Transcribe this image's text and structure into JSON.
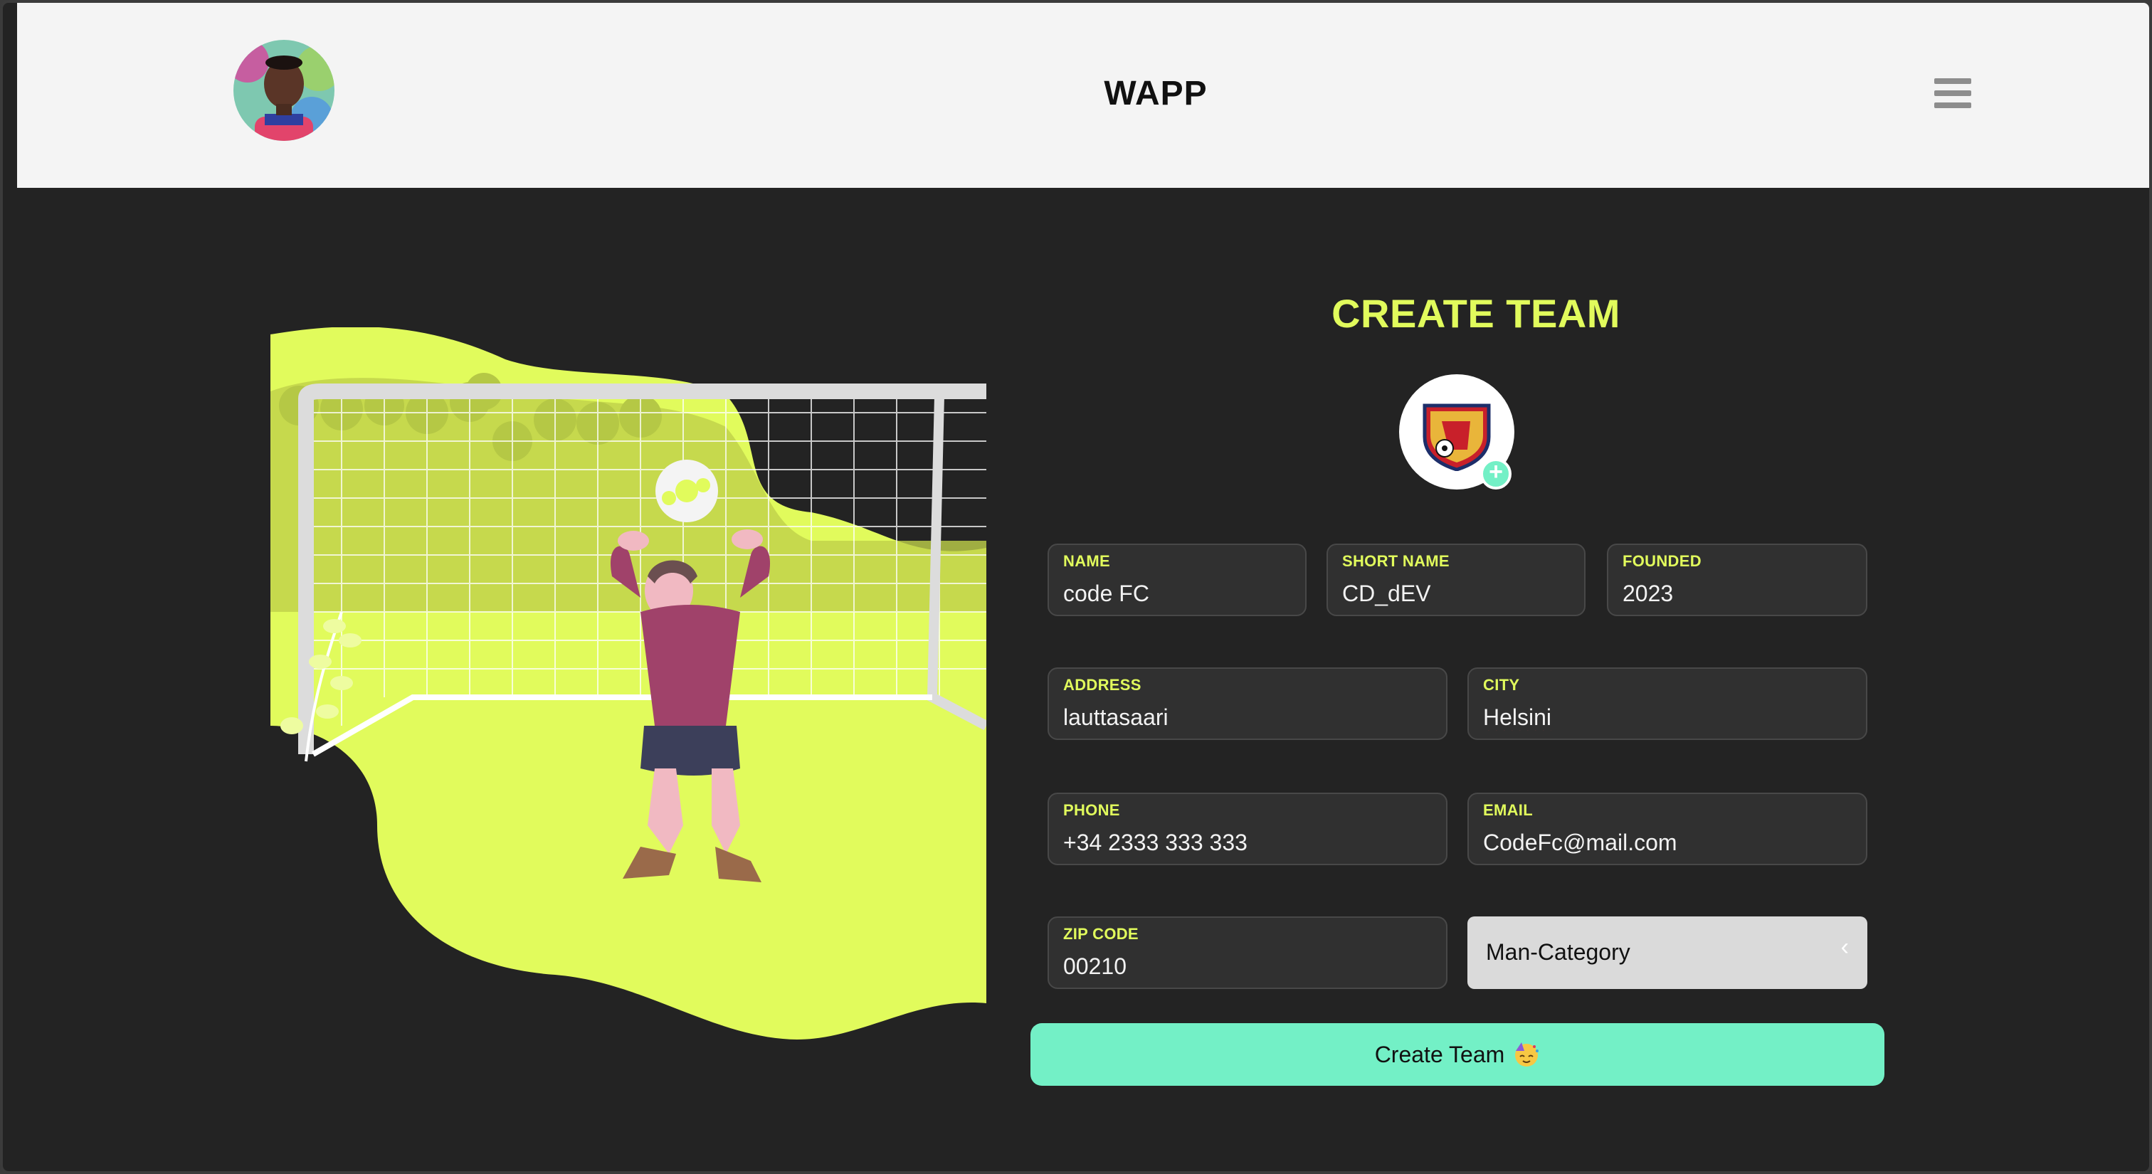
{
  "header": {
    "app_title": "WAPP",
    "avatar_icon": "user-avatar",
    "menu_icon": "hamburger-menu-icon"
  },
  "form": {
    "title": "CREATE TEAM",
    "logo_icon": "team-crest-icon",
    "add_logo_icon": "plus-icon",
    "fields": {
      "name": {
        "label": "NAME",
        "value": "code FC"
      },
      "short_name": {
        "label": "SHORT NAME",
        "value": "CD_dEV"
      },
      "founded": {
        "label": "FOUNDED",
        "value": "2023"
      },
      "address": {
        "label": "ADDRESS",
        "value": "lauttasaari"
      },
      "city": {
        "label": "CITY",
        "value": "Helsini"
      },
      "phone": {
        "label": "PHONE",
        "value": "+34 2333 333 333"
      },
      "email": {
        "label": "EMAIL",
        "value": "CodeFc@mail.com"
      },
      "zip": {
        "label": "ZIP CODE",
        "value": "00210"
      }
    },
    "category": {
      "selected": "Man-Category",
      "chevron": "‹"
    },
    "submit": {
      "label": "Create Team",
      "emoji": "partying-face-emoji"
    }
  },
  "colors": {
    "accent": "#e1fb5c",
    "button": "#73f0c6",
    "background": "#232323",
    "header": "#f4f4f4",
    "field": "#303030"
  }
}
